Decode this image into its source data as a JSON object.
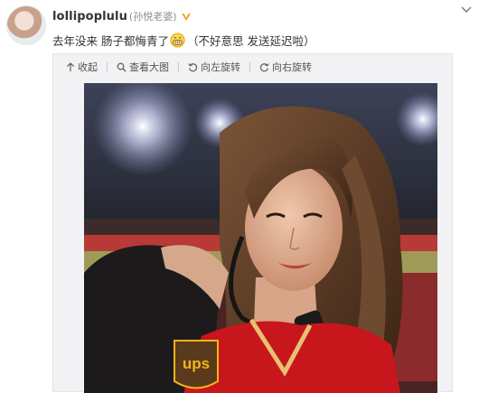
{
  "post": {
    "username": "lollipoplulu",
    "remark": "(孙悦老婆)",
    "text_before_emoji": "去年没来 肠子都悔青了",
    "emoji": "grin-emoji",
    "text_after_emoji": "（不好意思 发送延迟啦）"
  },
  "toolbar": {
    "collapse_label": "收起",
    "view_large_label": "查看大图",
    "rotate_left_label": "向左旋转",
    "rotate_right_label": "向右旋转"
  },
  "icons": {
    "verified": "verified-badge-icon",
    "more": "chevron-down-icon",
    "collapse": "collapse-up-icon",
    "view_large": "magnifier-icon",
    "rotate_left": "rotate-left-icon",
    "rotate_right": "rotate-right-icon"
  },
  "photo": {
    "description_text": "",
    "jersey_logo_text": "ups"
  },
  "colors": {
    "username": "#333333",
    "remark": "#8c8c8c",
    "verified_badge": "#f5a623",
    "jersey": "#c8161d",
    "ups_brown": "#5a3a1c",
    "ups_gold": "#f2b418"
  }
}
